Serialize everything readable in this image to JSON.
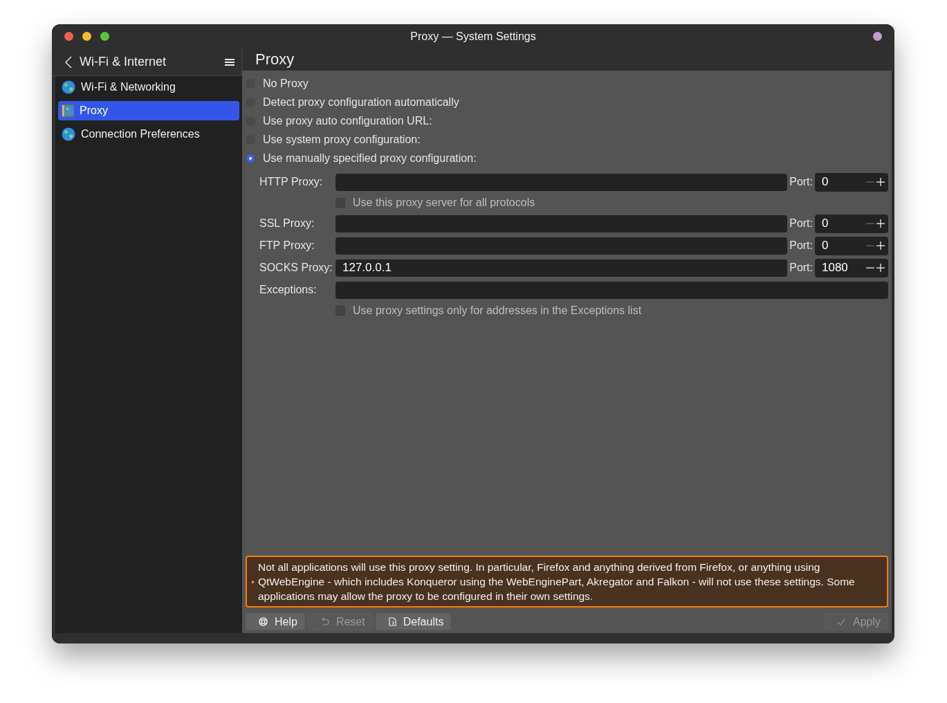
{
  "window": {
    "title": "Proxy — System Settings"
  },
  "sidebar": {
    "back_title": "Wi-Fi & Internet",
    "items": [
      {
        "label": "Wi-Fi & Networking",
        "kind": "globe",
        "selected": false
      },
      {
        "label": "Proxy",
        "kind": "proxy",
        "selected": true
      },
      {
        "label": "Connection Preferences",
        "kind": "globe",
        "selected": false
      }
    ]
  },
  "page_title": "Proxy",
  "modes": [
    {
      "label": "No Proxy",
      "selected": false
    },
    {
      "label": "Detect proxy configuration automatically",
      "selected": false
    },
    {
      "label": "Use proxy auto configuration URL:",
      "selected": false
    },
    {
      "label": "Use system proxy configuration:",
      "selected": false
    },
    {
      "label": "Use manually specified proxy configuration:",
      "selected": true
    }
  ],
  "proxies": [
    {
      "kind": "proxy",
      "label": "HTTP Proxy:",
      "port_label": "Port:",
      "port": "0",
      "decrease_disabled": true
    },
    {
      "kind": "checkbox",
      "label": "Use this proxy server for all protocols",
      "checked": false,
      "disabled": true
    },
    {
      "kind": "proxy",
      "label": "SSL Proxy:",
      "port_label": "Port:",
      "port": "0",
      "decrease_disabled": true
    },
    {
      "kind": "proxy",
      "label": "FTP Proxy:",
      "port_label": "Port:",
      "port": "0",
      "decrease_disabled": true
    },
    {
      "kind": "proxy",
      "label": "SOCKS Proxy:",
      "value": "127.0.0.1",
      "port_label": "Port:",
      "port": "1080",
      "decrease_disabled": false
    },
    {
      "kind": "field",
      "label": "Exceptions:"
    },
    {
      "kind": "checkbox",
      "label": "Use proxy settings only for addresses in the Exceptions list",
      "checked": false,
      "disabled": true
    }
  ],
  "warning": "Not all applications will use this proxy setting. In particular, Firefox and anything derived from Firefox, or anything using QtWebEngine - which includes Konqueror using the WebEnginePart, Akregator and Falkon - will not use these settings. Some applications may allow the proxy to be configured in their own settings.",
  "buttons": [
    {
      "label": "Help",
      "kind": "help",
      "disabled": false
    },
    {
      "label": "Reset",
      "kind": "reset",
      "disabled": true
    },
    {
      "label": "Defaults",
      "kind": "defaults",
      "disabled": false
    },
    {
      "label": "Apply",
      "kind": "apply",
      "disabled": true
    }
  ]
}
